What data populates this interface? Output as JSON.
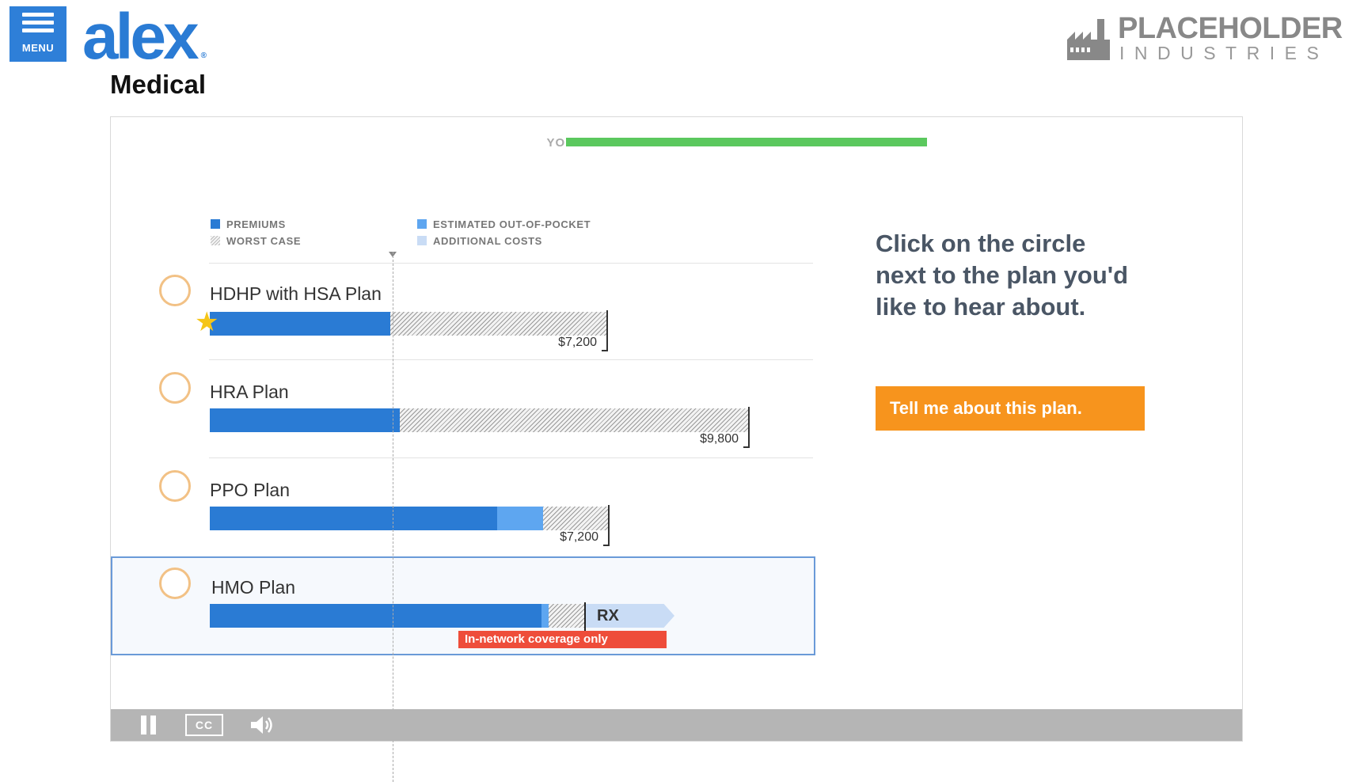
{
  "header": {
    "menu_label": "MENU",
    "logo_text": "alex",
    "logo_mark": "®",
    "brand_line1": "PLACEHOLDER",
    "brand_line2": "INDUSTRIES",
    "page_title": "Medical"
  },
  "progress": {
    "label": "YOUR PROGRESS:",
    "fraction": 1.0,
    "color": "#5bc85e"
  },
  "legend": {
    "premiums": "PREMIUMS",
    "worst_case": "WORST CASE",
    "out_of_pocket": "ESTIMATED OUT-OF-POCKET",
    "additional": "ADDITIONAL COSTS"
  },
  "plans": [
    {
      "name": "HDHP with HSA Plan",
      "amount": "$7,200",
      "recommended": true
    },
    {
      "name": "HRA Plan",
      "amount": "$9,800"
    },
    {
      "name": "PPO Plan",
      "amount": "$7,200"
    },
    {
      "name": "HMO Plan",
      "rx_label": "RX",
      "coverage_note": "In-network coverage only",
      "selected": true
    }
  ],
  "instruction": "Click on the circle next to the plan you'd like to hear about.",
  "cta_label": "Tell me about this plan.",
  "controls": {
    "cc_label": "CC",
    "icons": [
      "pause-icon",
      "closed-caption-icon",
      "volume-icon"
    ]
  },
  "colors": {
    "accent_blue": "#2a7bd4",
    "cta_orange": "#f7941d",
    "alert_red": "#ee4d3a"
  }
}
